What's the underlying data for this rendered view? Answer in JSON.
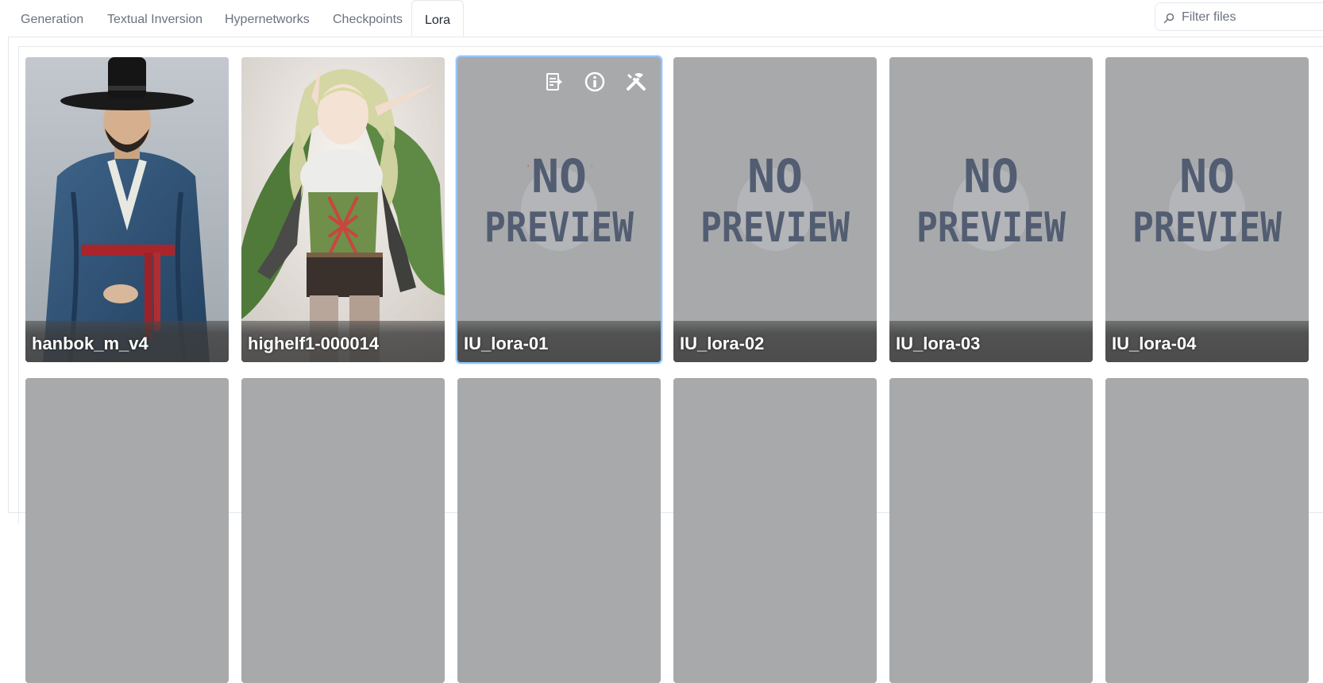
{
  "tabs": [
    {
      "label": "Generation",
      "active": false
    },
    {
      "label": "Textual Inversion",
      "active": false
    },
    {
      "label": "Hypernetworks",
      "active": false
    },
    {
      "label": "Checkpoints",
      "active": false
    },
    {
      "label": "Lora",
      "active": true
    }
  ],
  "search": {
    "placeholder": "Filter files",
    "value": ""
  },
  "cards_row1": [
    {
      "name": "hanbok_m_v4",
      "preview": "photo-man-hanbok"
    },
    {
      "name": "highelf1-000014",
      "preview": "illustration-elf"
    },
    {
      "name": "IU_lora-01",
      "preview": "no-preview",
      "selected": true
    },
    {
      "name": "IU_lora-02",
      "preview": "no-preview"
    },
    {
      "name": "IU_lora-03",
      "preview": "no-preview"
    },
    {
      "name": "IU_lora-04",
      "preview": "no-preview"
    }
  ],
  "card_actions": [
    "copy-icon",
    "info-icon",
    "tools-icon"
  ],
  "no_preview_text": {
    "line1": "NO",
    "line2": "PREVIEW"
  },
  "colors": {
    "placeholder_card": "#a7a9ab",
    "selected_outline": "#93c5fd",
    "accent_blue": "#4b5a75"
  }
}
